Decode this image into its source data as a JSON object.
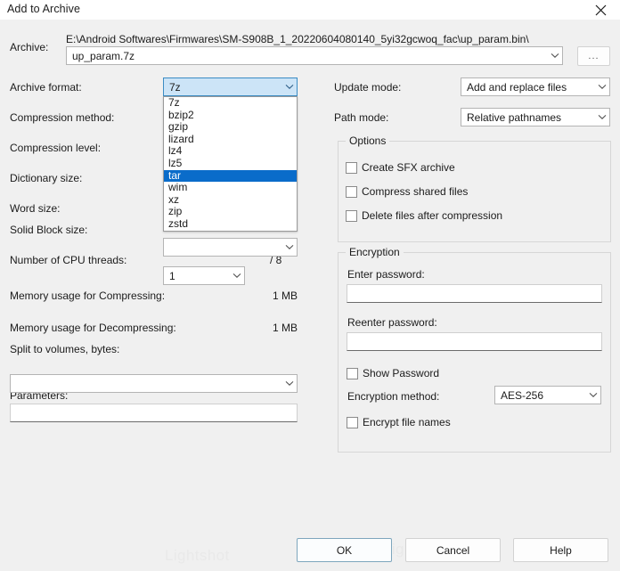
{
  "window": {
    "title": "Add to Archive",
    "close_icon": "close-icon"
  },
  "archive": {
    "label": "Archive:",
    "path_text": "E:\\Android Softwares\\Firmwares\\SM-S908B_1_20220604080140_5yi32gcwoq_fac\\up_param.bin\\",
    "name_value": "up_param.7z",
    "browse_label": "..."
  },
  "left": {
    "archive_format": {
      "label": "Archive format:",
      "value": "7z",
      "open": true,
      "options": [
        "7z",
        "bzip2",
        "gzip",
        "lizard",
        "lz4",
        "lz5",
        "tar",
        "wim",
        "xz",
        "zip",
        "zstd"
      ],
      "highlighted": "tar"
    },
    "compression_method": {
      "label": "Compression method:",
      "value": ""
    },
    "compression_level": {
      "label": "Compression level:",
      "value": ""
    },
    "dictionary_size": {
      "label": "Dictionary size:",
      "value": ""
    },
    "word_size": {
      "label": "Word size:",
      "value": ""
    },
    "solid_block_size": {
      "label": "Solid Block size:",
      "value": ""
    },
    "cpu_threads": {
      "label": "Number of CPU threads:",
      "value": "1",
      "total": "/ 8"
    },
    "mem_compress": {
      "label": "Memory usage for Compressing:",
      "value": "1 MB"
    },
    "mem_decompress": {
      "label": "Memory usage for Decompressing:",
      "value": "1 MB"
    },
    "split_volumes": {
      "label": "Split to volumes, bytes:",
      "value": ""
    },
    "parameters": {
      "label": "Parameters:",
      "value": ""
    }
  },
  "right": {
    "update_mode": {
      "label": "Update mode:",
      "value": "Add and replace files"
    },
    "path_mode": {
      "label": "Path mode:",
      "value": "Relative pathnames"
    },
    "options": {
      "title": "Options",
      "items": [
        {
          "label": "Create SFX archive",
          "checked": false
        },
        {
          "label": "Compress shared files",
          "checked": false
        },
        {
          "label": "Delete files after compression",
          "checked": false
        }
      ]
    },
    "encryption": {
      "title": "Encryption",
      "enter_password_label": "Enter password:",
      "enter_password_value": "",
      "reenter_password_label": "Reenter password:",
      "reenter_password_value": "",
      "show_password": {
        "label": "Show Password",
        "checked": false
      },
      "method_label": "Encryption method:",
      "method_value": "AES-256",
      "encrypt_file_names": {
        "label": "Encrypt file names",
        "checked": false
      }
    }
  },
  "footer": {
    "ok": "OK",
    "cancel": "Cancel",
    "help": "Help"
  },
  "watermark": {
    "text": "Lightshot"
  },
  "colors": {
    "dialog_bg": "#f0f0f0",
    "selection_blue": "#0a6cca",
    "focus_combo_bg": "#cce4f7",
    "focus_combo_border": "#3b8cc4",
    "default_button_border": "#7ea6bd"
  }
}
